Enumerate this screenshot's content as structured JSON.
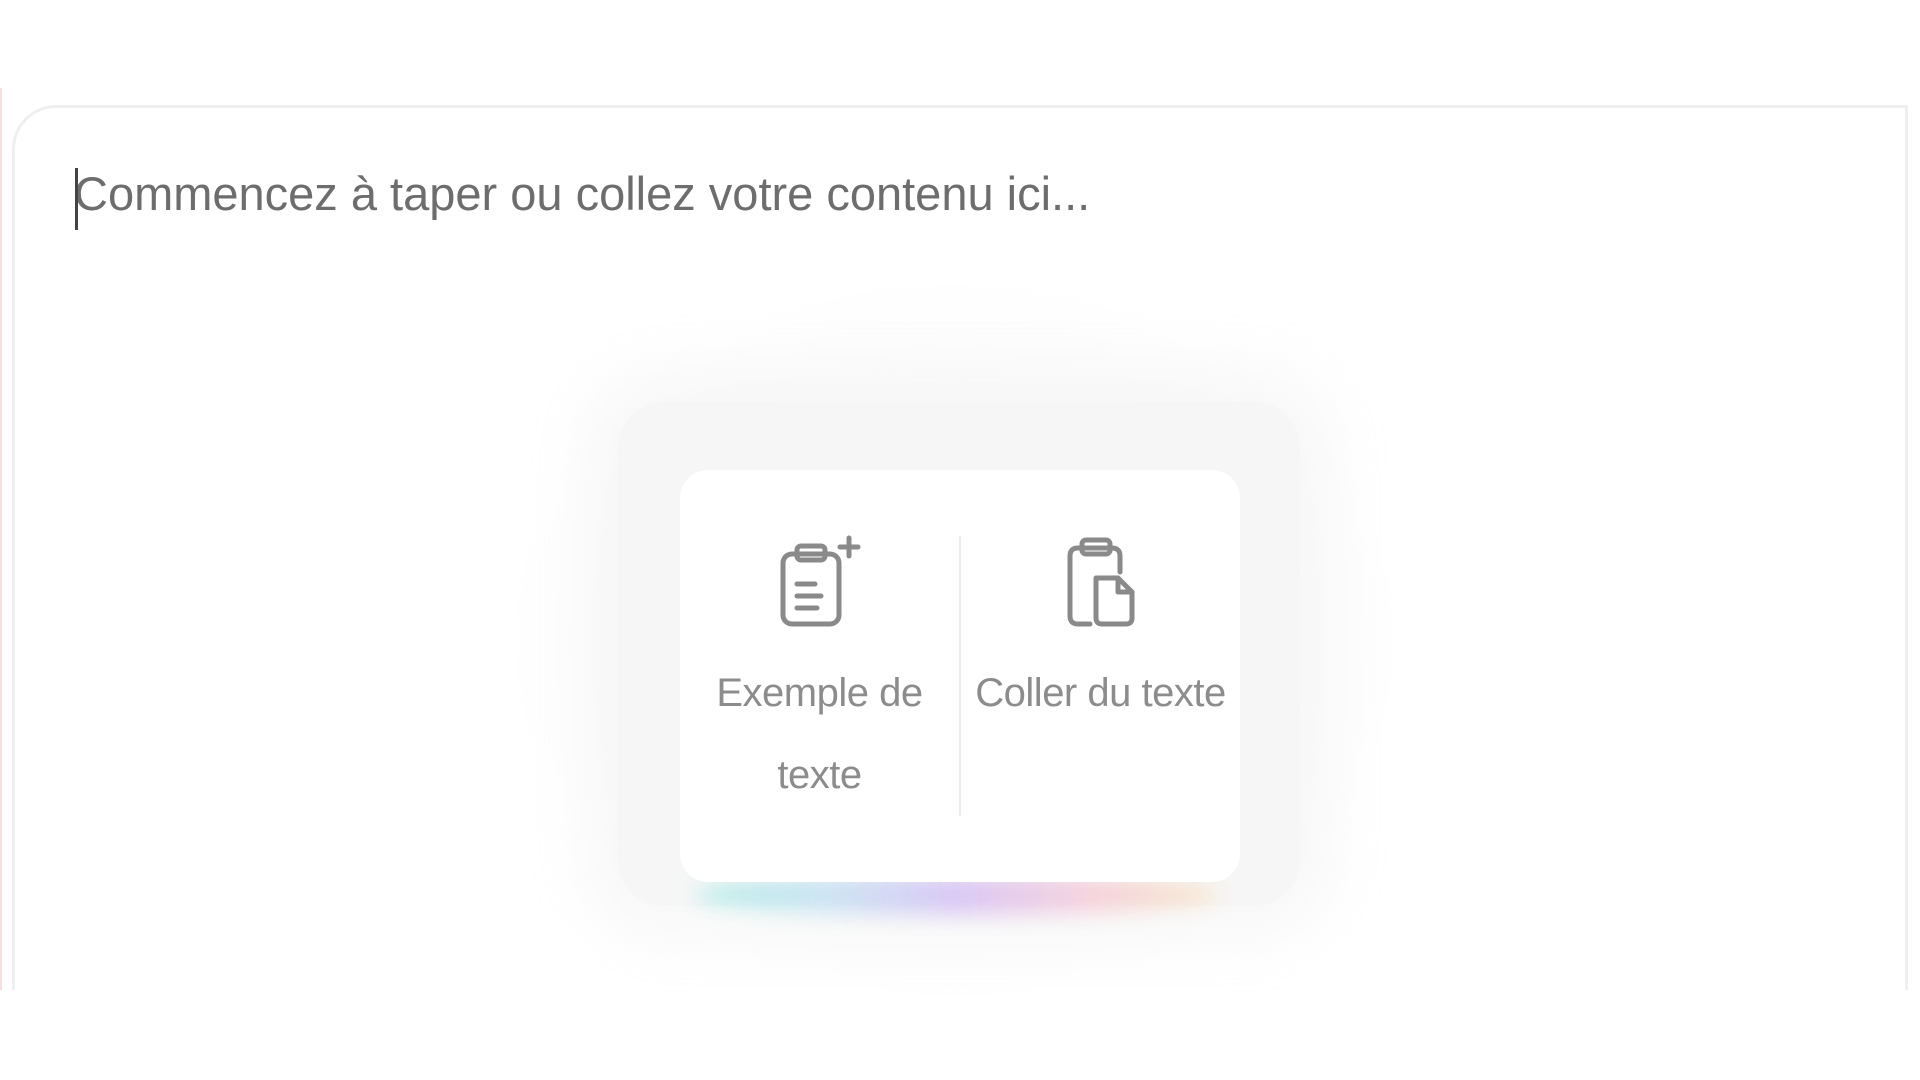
{
  "editor": {
    "placeholder": "Commencez à taper ou collez votre contenu ici..."
  },
  "actions": [
    {
      "label": "Exemple de texte",
      "icon": "clipboard-add-icon"
    },
    {
      "label": "Coller du texte",
      "icon": "paste-icon"
    }
  ],
  "colors": {
    "icon_stroke": "#8a8a8a",
    "label_text": "#8c8c8c",
    "placeholder_text": "#6d6d6d"
  }
}
